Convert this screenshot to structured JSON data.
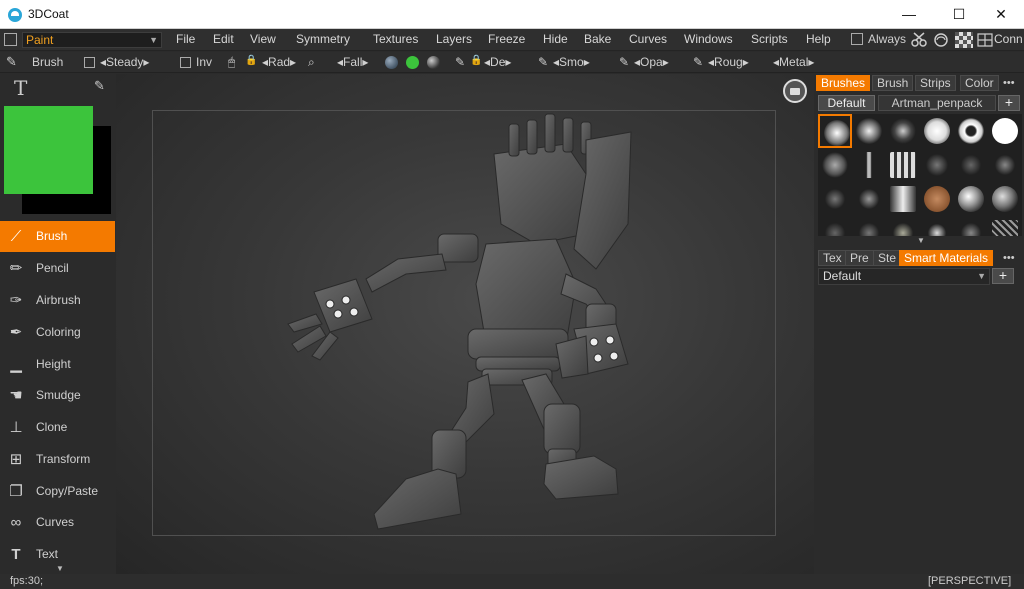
{
  "window": {
    "title": "3DCoat",
    "minimize": "—",
    "maximize": "☐",
    "close": "✕"
  },
  "menubar": {
    "room": "Paint",
    "items": [
      "File",
      "Edit",
      "View",
      "Symmetry",
      "Textures",
      "Layers",
      "Freeze",
      "Hide",
      "Bake",
      "Curves",
      "Windows",
      "Scripts",
      "Help"
    ],
    "always_label": "Always",
    "conn_label": "Conn"
  },
  "toolbar": {
    "brush_label": "Brush",
    "steady": "◂Steady▸",
    "inv": "Inv",
    "rad": "◂Rad▸",
    "fall": "◂Fall▸",
    "de": "◂De▸",
    "smo": "◂Smo▸",
    "opa": "◂Opa▸",
    "roug": "◂Roug▸",
    "metal": "◂Metal▸",
    "color_swatch": "#3cc43c"
  },
  "colors": {
    "primary": "#3cc43c",
    "secondary": "#000000",
    "accent": "#f47a00"
  },
  "tools": [
    {
      "label": "Brush",
      "icon": "brush-icon",
      "active": true
    },
    {
      "label": "Pencil",
      "icon": "pencil-icon",
      "active": false
    },
    {
      "label": "Airbrush",
      "icon": "airbrush-icon",
      "active": false
    },
    {
      "label": "Coloring",
      "icon": "coloring-icon",
      "active": false
    },
    {
      "label": "Height",
      "icon": "height-icon",
      "active": false
    },
    {
      "label": "Smudge",
      "icon": "smudge-icon",
      "active": false
    },
    {
      "label": "Clone",
      "icon": "clone-icon",
      "active": false
    },
    {
      "label": "Transform",
      "icon": "transform-icon",
      "active": false
    },
    {
      "label": "Copy/Paste",
      "icon": "copy-paste-icon",
      "active": false
    },
    {
      "label": "Curves",
      "icon": "curves-icon",
      "active": false
    },
    {
      "label": "Text",
      "icon": "text-icon",
      "active": false
    }
  ],
  "right_panel": {
    "top_tabs": [
      "Brushes",
      "Brush",
      "Strips",
      "Color"
    ],
    "preset_tabs": [
      "Default",
      "Artman_penpack"
    ],
    "plus": "+",
    "bottom_tabs": [
      "Tex",
      "Pre",
      "Ste",
      "Smart Materials"
    ],
    "material_value": "Default",
    "more": "•••"
  },
  "status": {
    "fps": "fps:30;",
    "projection": "[PERSPECTIVE]"
  }
}
